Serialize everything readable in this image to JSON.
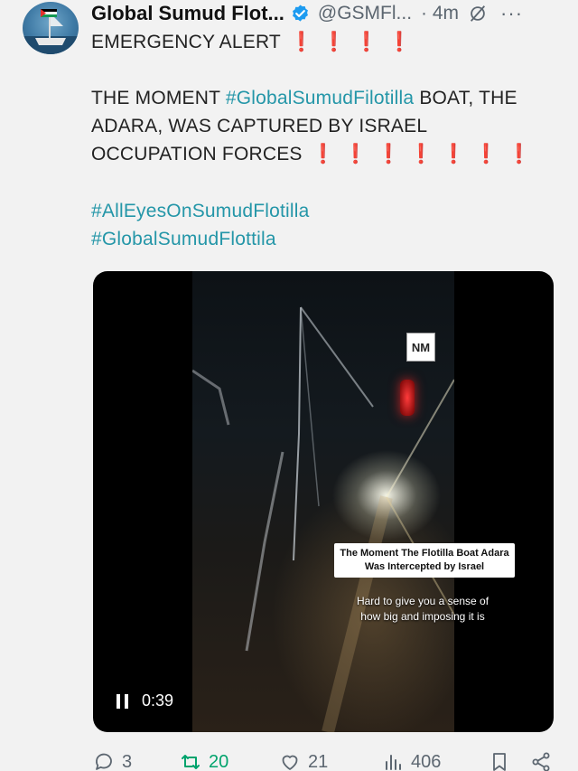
{
  "author": {
    "display_name": "Global Sumud Flot...",
    "handle": "@GSMFl...",
    "time": "· 4m",
    "more": "···"
  },
  "post": {
    "line1_text": "EMERGENCY ALERT",
    "line1_bangs": "❗❗❗❗",
    "line2_prefix": "THE MOMENT ",
    "line2_hashtag": "#GlobalSumudFilotilla",
    "line2_suffix": " BOAT, THE",
    "line3": "ADARA, WAS CAPTURED BY ISRAEL",
    "line4_text": "OCCUPATION FORCES",
    "line4_bangs": "❗❗❗❗❗❗❗",
    "hashtag1": "#AllEyesOnSumudFlotilla",
    "hashtag2": "#GlobalSumudFlottila"
  },
  "video": {
    "logo": "NM",
    "caption": "The Moment The Flotilla Boat Adara Was Intercepted by Israel",
    "subtitle_line1": "Hard to give you a sense of",
    "subtitle_line2": "how big and imposing it is",
    "duration": "0:39"
  },
  "actions": {
    "replies": "3",
    "reposts": "20",
    "likes": "21",
    "views": "406"
  },
  "colors": {
    "hashtag": "#2496a8",
    "alert": "#d0122a",
    "repost_active": "#00a36c",
    "verified": "#1d9bf0"
  }
}
